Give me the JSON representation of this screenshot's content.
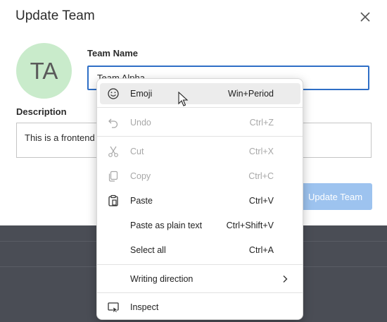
{
  "modal": {
    "title": "Update Team",
    "avatar_initials": "TA",
    "team_name_label": "Team Name",
    "team_name_value": "Team Alpha",
    "description_label": "Description",
    "description_value": "This is a frontend",
    "update_button": "Update Team"
  },
  "context_menu": {
    "items": [
      {
        "label": "Emoji",
        "shortcut": "Win+Period",
        "icon": "emoji-icon",
        "state": "hover"
      },
      {
        "label": "Undo",
        "shortcut": "Ctrl+Z",
        "icon": "undo-icon",
        "state": "disabled"
      },
      {
        "label": "Cut",
        "shortcut": "Ctrl+X",
        "icon": "cut-icon",
        "state": "disabled"
      },
      {
        "label": "Copy",
        "shortcut": "Ctrl+C",
        "icon": "copy-icon",
        "state": "disabled"
      },
      {
        "label": "Paste",
        "shortcut": "Ctrl+V",
        "icon": "paste-icon",
        "state": "enabled"
      },
      {
        "label": "Paste as plain text",
        "shortcut": "Ctrl+Shift+V",
        "icon": "",
        "state": "enabled"
      },
      {
        "label": "Select all",
        "shortcut": "Ctrl+A",
        "icon": "",
        "state": "enabled"
      },
      {
        "label": "Writing direction",
        "shortcut": "",
        "icon": "chevron-right-icon",
        "state": "enabled"
      },
      {
        "label": "Inspect",
        "shortcut": "",
        "icon": "inspect-icon",
        "state": "enabled"
      }
    ]
  },
  "colors": {
    "accent": "#2f6fc6",
    "button_disabled": "#9dc3ef",
    "avatar_bg": "#c9ebcb",
    "backdrop": "#4a4d55"
  }
}
